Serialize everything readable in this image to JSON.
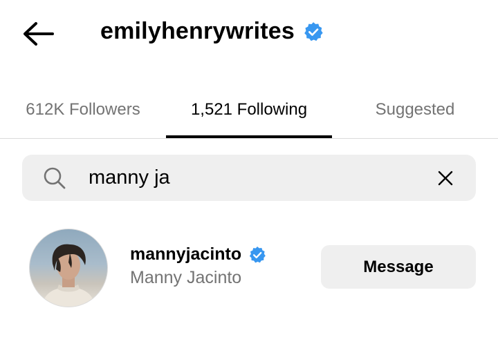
{
  "header": {
    "title": "emilyhenrywrites",
    "verified": true,
    "back_icon": "back-arrow-icon"
  },
  "tabs": [
    {
      "label": "612K Followers",
      "active": false
    },
    {
      "label": "1,521 Following",
      "active": true
    },
    {
      "label": "Suggested",
      "active": false
    }
  ],
  "search": {
    "value": "manny ja",
    "icon": "search-icon",
    "clear_icon": "close-icon"
  },
  "results": [
    {
      "username": "mannyjacinto",
      "full_name": "Manny Jacinto",
      "verified": true,
      "button_label": "Message"
    }
  ],
  "colors": {
    "verified_blue": "#3897f0",
    "secondary_text": "#737373",
    "field_bg": "#efefef"
  }
}
